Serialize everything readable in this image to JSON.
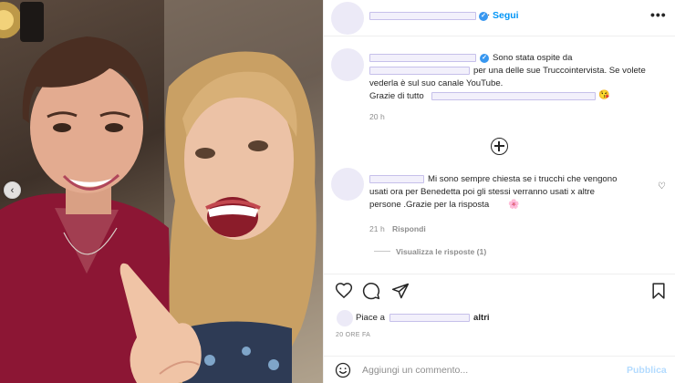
{
  "post": {
    "follow_label": "Segui",
    "more_label": "•••",
    "caption": {
      "line1": "Sono stata ospite da",
      "line2": "per una delle sue Truccointervista. Se volete",
      "line3": "vederla è sul suo canale YouTube.",
      "line4": "Grazie di tutto",
      "emoji": "😘",
      "time": "20 h"
    },
    "comment": {
      "line1": "Mi sono sempre chiesta se i trucchi che vengono",
      "line2": "usati ora per Benedetta poi gli stessi verranno usati x altre",
      "line3": "persone .Grazie per la risposta",
      "emoji": "🌸",
      "time": "21 h",
      "reply_label": "Rispondi",
      "view_replies": "Visualizza le risposte (1)"
    },
    "likes": {
      "prefix": "Piace a",
      "suffix": "altri"
    },
    "date": "20 ORE FA",
    "add_comment": {
      "placeholder": "Aggiungi un commento...",
      "publish_label": "Pubblica"
    }
  },
  "icons": {
    "verified": "verified-badge-icon",
    "options": "more-options-icon",
    "load_more": "plus-circle-icon",
    "like": "heart-icon",
    "comment": "comment-icon",
    "share": "share-icon",
    "save": "bookmark-icon",
    "emoji": "emoji-icon",
    "carousel": "chevron-left-icon"
  },
  "colors": {
    "accent": "#0095f6",
    "verified": "#3897f0",
    "muted": "#8e8e8e",
    "publish_disabled": "#b3dbff"
  }
}
